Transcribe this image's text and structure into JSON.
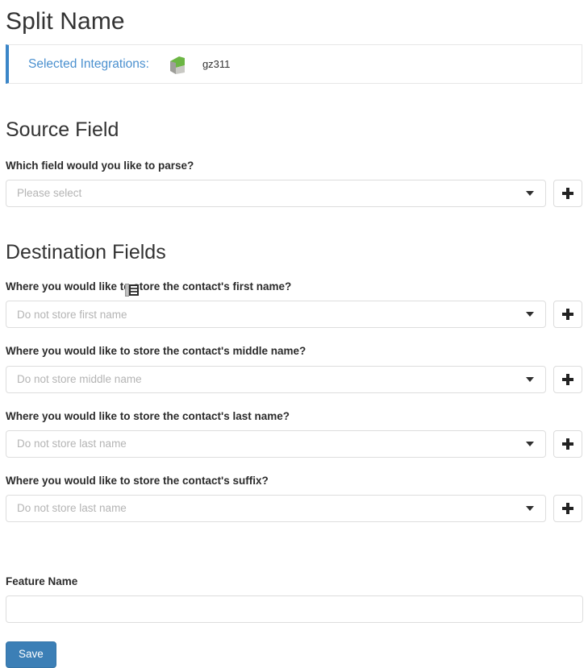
{
  "page": {
    "title": "Split Name"
  },
  "alert": {
    "label": "Selected Integrations:",
    "integration_icon": "integration-flag-icon",
    "integration_name": "gz311",
    "accent_color": "#3b86c8",
    "label_color": "#4a90cf"
  },
  "source_section": {
    "heading": "Source Field",
    "field": {
      "label": "Which field would you like to parse?",
      "value": "Please select",
      "caret_icon": "chevron-down-icon",
      "add_icon": "plus-icon"
    }
  },
  "destination_section": {
    "heading": "Destination Fields",
    "fields": [
      {
        "label": "Where you would like to store the contact's first name?",
        "value": "Do not store first name",
        "caret_icon": "chevron-down-icon",
        "add_icon": "plus-icon"
      },
      {
        "label": "Where you would like to store the contact's middle name?",
        "value": "Do not store middle name",
        "caret_icon": "chevron-down-icon",
        "add_icon": "plus-icon"
      },
      {
        "label": "Where you would like to store the contact's last name?",
        "value": "Do not store last name",
        "caret_icon": "chevron-down-icon",
        "add_icon": "plus-icon"
      },
      {
        "label": "Where you would like to store the contact's suffix?",
        "value": "Do not store last name",
        "caret_icon": "chevron-down-icon",
        "add_icon": "plus-icon"
      }
    ]
  },
  "feature": {
    "label": "Feature Name",
    "value": "",
    "placeholder": ""
  },
  "actions": {
    "save_label": "Save",
    "save_color": "#3c7fb6"
  },
  "cursor": {
    "icon": "text-ibeam-cursor"
  }
}
